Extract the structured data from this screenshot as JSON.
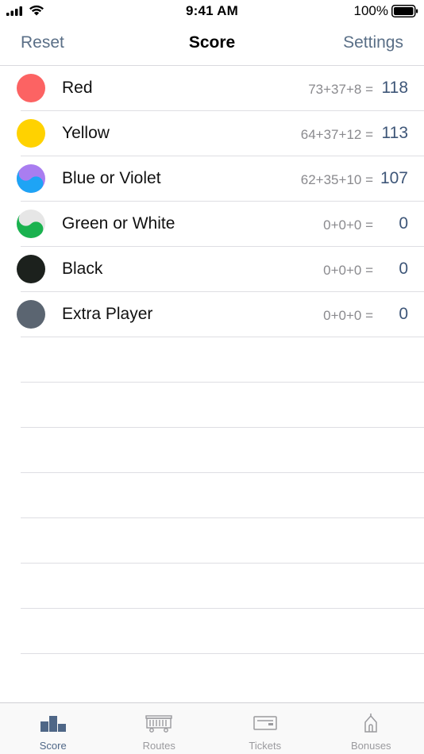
{
  "status_bar": {
    "time": "9:41 AM",
    "battery_percent": "100%"
  },
  "nav": {
    "left_label": "Reset",
    "title": "Score",
    "right_label": "Settings",
    "accent_color": "#5a6f87"
  },
  "players": [
    {
      "name": "Red",
      "formula": "73+37+8 =",
      "total": "118",
      "colors": [
        "#fc6363"
      ]
    },
    {
      "name": "Yellow",
      "formula": "64+37+12 =",
      "total": "113",
      "colors": [
        "#ffd200"
      ]
    },
    {
      "name": "Blue or Violet",
      "formula": "62+35+10 =",
      "total": "107",
      "colors": [
        "#1ea4f5",
        "#a97df0"
      ]
    },
    {
      "name": "Green or White",
      "formula": "0+0+0 =",
      "total": "0",
      "colors": [
        "#1ab24f",
        "#e6e6e6"
      ]
    },
    {
      "name": "Black",
      "formula": "0+0+0 =",
      "total": "0",
      "colors": [
        "#1c211d"
      ]
    },
    {
      "name": "Extra Player",
      "formula": "0+0+0 =",
      "total": "0",
      "colors": [
        "#5b6571"
      ]
    }
  ],
  "tabs": [
    {
      "label": "Score",
      "icon": "podium-icon",
      "active": true
    },
    {
      "label": "Routes",
      "icon": "train-car-icon",
      "active": false
    },
    {
      "label": "Tickets",
      "icon": "ticket-icon",
      "active": false
    },
    {
      "label": "Bonuses",
      "icon": "station-icon",
      "active": false
    }
  ]
}
